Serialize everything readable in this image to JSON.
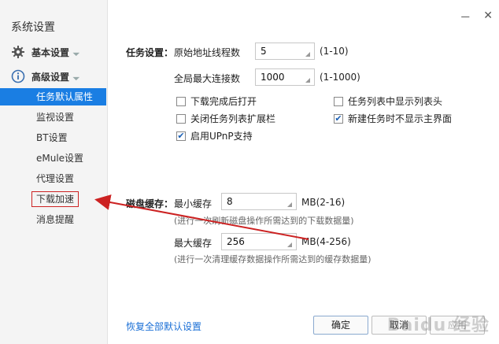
{
  "window": {
    "title": "系统设置",
    "minimize": "－",
    "close": "✕"
  },
  "sidebar": {
    "groups": [
      {
        "label": "基本设置",
        "icon": "gear-icon"
      },
      {
        "label": "高级设置",
        "icon": "info-icon"
      }
    ],
    "items": [
      {
        "label": "任务默认属性",
        "active": true
      },
      {
        "label": "监视设置"
      },
      {
        "label": "BT设置"
      },
      {
        "label": "eMule设置"
      },
      {
        "label": "代理设置"
      },
      {
        "label": "下载加速",
        "highlighted": true
      },
      {
        "label": "消息提醒"
      }
    ]
  },
  "task": {
    "section_label": "任务设置：",
    "threads_label": "原始地址线程数",
    "threads_value": "5",
    "threads_range": "(1-10)",
    "max_conn_label": "全局最大连接数",
    "max_conn_value": "1000",
    "max_conn_range": "(1-1000)"
  },
  "checkboxes": [
    {
      "label": "下载完成后打开",
      "checked": false
    },
    {
      "label": "任务列表中显示列表头",
      "checked": false
    },
    {
      "label": "关闭任务列表扩展栏",
      "checked": false
    },
    {
      "label": "新建任务时不显示主界面",
      "checked": true
    },
    {
      "label": "启用UPnP支持",
      "checked": true
    }
  ],
  "cache": {
    "section_label": "磁盘缓存：",
    "min_label": "最小缓存",
    "min_value": "8",
    "min_unit": "MB(2-16)",
    "min_hint": "(进行一次刷新磁盘操作所需达到的下载数据量)",
    "max_label": "最大缓存",
    "max_value": "256",
    "max_unit": "MB(4-256)",
    "max_hint": "(进行一次清理缓存数据操作所需达到的缓存数据量)"
  },
  "footer": {
    "restore_label": "恢复全部默认设置",
    "ok_label": "确定",
    "cancel_label": "取消",
    "apply_label": "应用"
  },
  "watermark": "Baidu 经验",
  "colors": {
    "accent": "#1a7ee3",
    "annotation": "#cc2222"
  }
}
